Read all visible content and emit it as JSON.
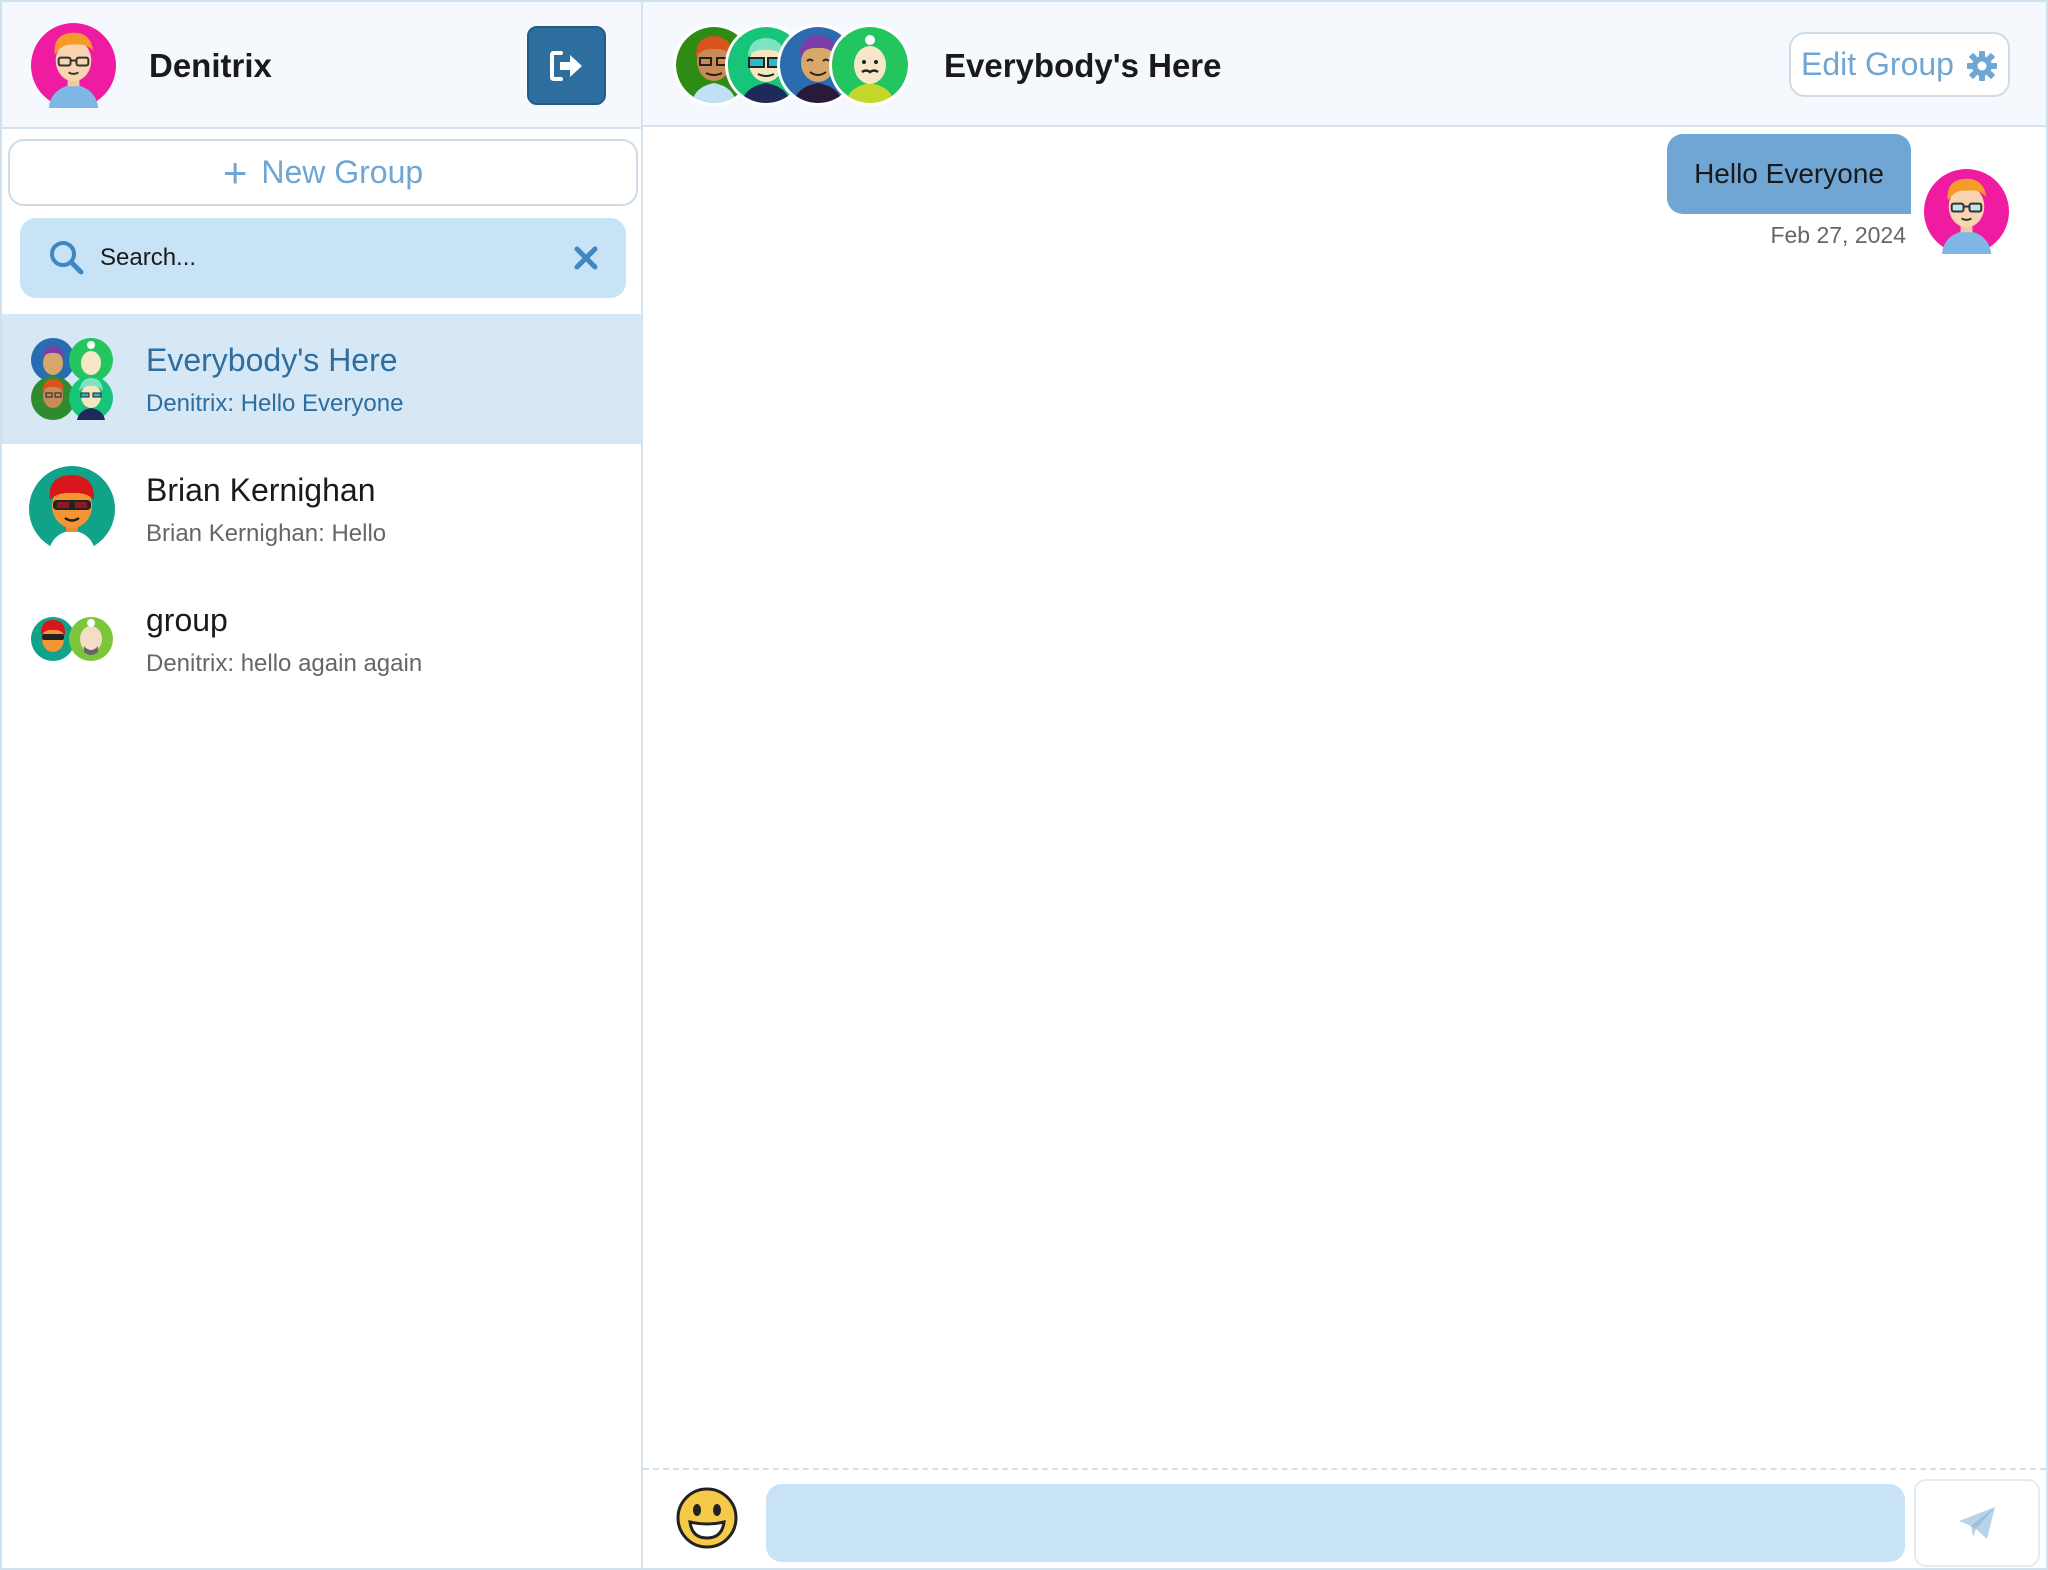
{
  "user": {
    "name": "Denitrix",
    "avatar_icon": "avatar-denitrix-icon"
  },
  "sidebar": {
    "logout_icon": "logout-icon",
    "new_group_label": "New Group",
    "new_group_icon": "plus-icon",
    "search": {
      "placeholder": "Search...",
      "search_icon": "search-icon",
      "clear_icon": "close-icon"
    },
    "conversations": [
      {
        "title": "Everybody's Here",
        "preview": "Denitrix: Hello Everyone",
        "active": true
      },
      {
        "title": "Brian Kernighan",
        "preview": "Brian Kernighan: Hello",
        "active": false
      },
      {
        "title": "group",
        "preview": "Denitrix: hello again again",
        "active": false
      }
    ]
  },
  "chat": {
    "title": "Everybody's Here",
    "edit_group_label": "Edit Group",
    "edit_group_icon": "gear-icon",
    "messages": [
      {
        "sender": "Denitrix",
        "text": "Hello Everyone",
        "date": "Feb 27, 2024",
        "outgoing": true
      }
    ],
    "composer": {
      "emoji_icon": "smiley-emoji-icon",
      "input_value": "",
      "send_icon": "paper-plane-icon"
    }
  },
  "colors": {
    "accent": "#2e6e9e",
    "accent_light": "#6fa6d3",
    "input_bg": "#c8e2f6",
    "active_row": "#d6e7f5",
    "header_bg": "#f5f9fd"
  }
}
